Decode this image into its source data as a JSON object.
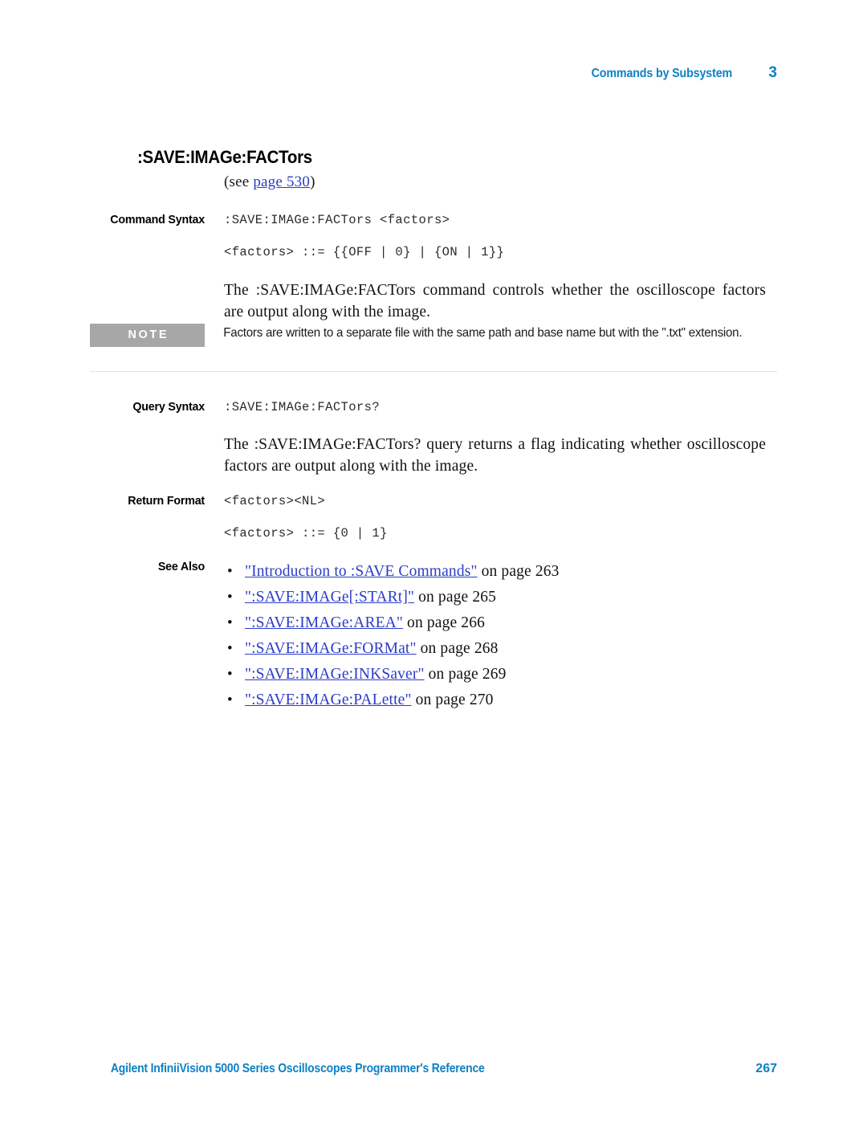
{
  "header": {
    "chapter_title": "Commands by Subsystem",
    "chapter_number": "3"
  },
  "section": {
    "title": ":SAVE:IMAGe:FACTors",
    "see_prefix": "(see ",
    "see_link": "page 530",
    "see_suffix": ")"
  },
  "command_syntax": {
    "label": "Command Syntax",
    "line1": ":SAVE:IMAGe:FACTors <factors>",
    "line2": "<factors> ::= {{OFF | 0} | {ON | 1}}",
    "description": "The :SAVE:IMAGe:FACTors command controls whether the oscilloscope factors are output along with the image."
  },
  "note": {
    "badge": "NOTE",
    "text": "Factors are written to a separate file with the same path and base name but with the \".txt\" extension."
  },
  "query_syntax": {
    "label": "Query Syntax",
    "line1": ":SAVE:IMAGe:FACTors?",
    "description": "The :SAVE:IMAGe:FACTors? query returns a flag indicating whether oscilloscope factors are output along with the image."
  },
  "return_format": {
    "label": "Return Format",
    "line1": "<factors><NL>",
    "line2": "<factors> ::= {0 | 1}"
  },
  "see_also": {
    "label": "See Also",
    "bullet": "•",
    "items": [
      {
        "link": "\"Introduction to :SAVE Commands\"",
        "tail": " on page 263"
      },
      {
        "link": "\":SAVE:IMAGe[:STARt]\"",
        "tail": " on page 265"
      },
      {
        "link": "\":SAVE:IMAGe:AREA\"",
        "tail": " on page 266"
      },
      {
        "link": "\":SAVE:IMAGe:FORMat\"",
        "tail": " on page 268"
      },
      {
        "link": "\":SAVE:IMAGe:INKSaver\"",
        "tail": " on page 269"
      },
      {
        "link": "\":SAVE:IMAGe:PALette\"",
        "tail": " on page 270"
      }
    ]
  },
  "footer": {
    "text": "Agilent InfiniiVision 5000 Series Oscilloscopes Programmer's Reference",
    "page": "267"
  },
  "colors": {
    "accent_blue": "#0d80c4",
    "link_blue": "#2a3cc8",
    "note_gray": "#a7a7a7",
    "rule_gray": "#e4e4e4"
  }
}
